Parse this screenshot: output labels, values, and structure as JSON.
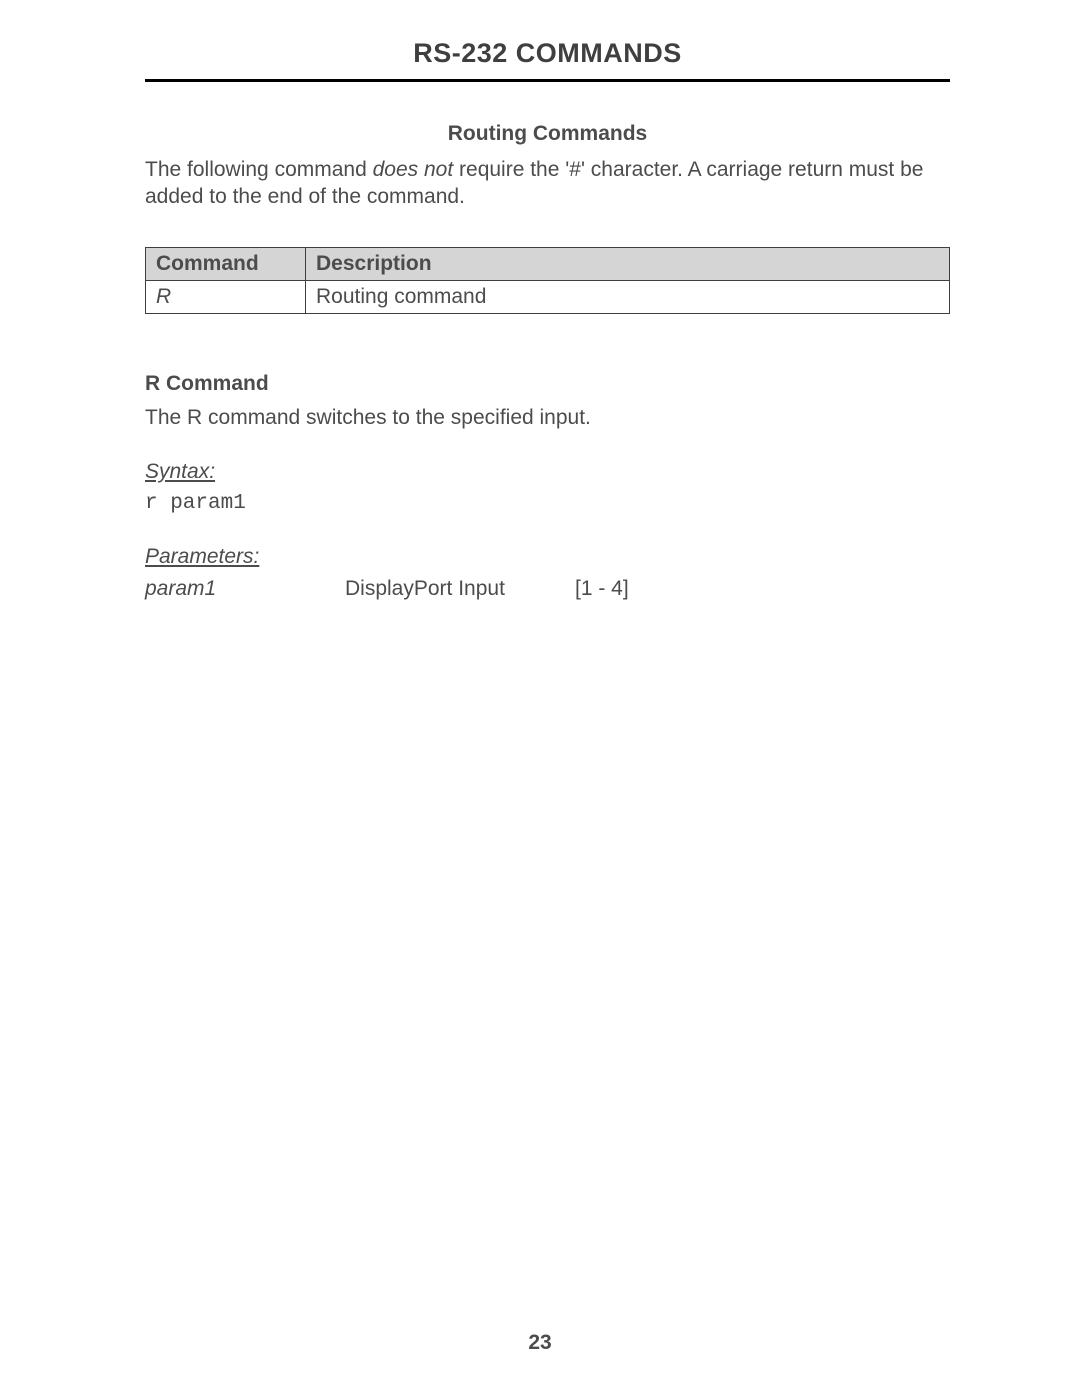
{
  "header": {
    "title": "RS-232 COMMANDS"
  },
  "section": {
    "heading": "Routing Commands",
    "intro_prefix": "The following command ",
    "intro_italic": "does not",
    "intro_suffix": " require the '#' character.  A carriage return must be added to the end of the command."
  },
  "command_table": {
    "headers": {
      "col1": "Command",
      "col2": "Description"
    },
    "row1": {
      "cmd": "R",
      "desc": "Routing command"
    }
  },
  "r_command": {
    "heading": "R Command",
    "description": "The R command switches to the specified input.",
    "syntax_label": "Syntax:",
    "syntax_code": "r param1",
    "parameters_label": "Parameters:",
    "param1_name": "param1",
    "param1_desc": "DisplayPort Input",
    "param1_range": "[1 - 4]"
  },
  "footer": {
    "page_number": "23"
  }
}
